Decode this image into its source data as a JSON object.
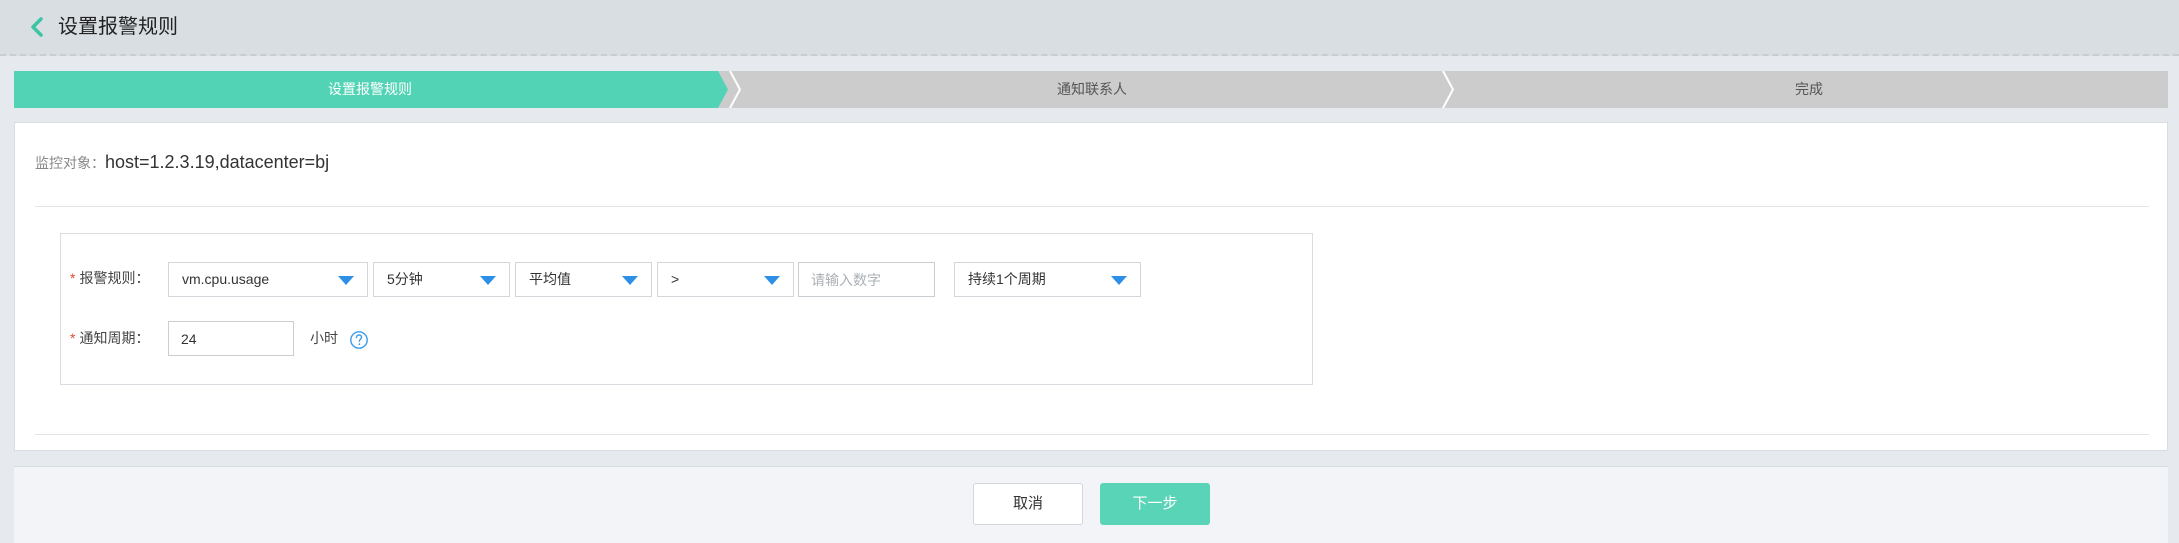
{
  "header": {
    "title": "设置报警规则",
    "back_icon": "chevron-left-icon"
  },
  "steps": [
    {
      "label": "设置报警规则",
      "active": true
    },
    {
      "label": "通知联系人",
      "active": false
    },
    {
      "label": "完成",
      "active": false
    }
  ],
  "monitor": {
    "label": "监控对象：",
    "value": "host=1.2.3.19,datacenter=bj"
  },
  "rule": {
    "label": "报警规则：",
    "metric": "vm.cpu.usage",
    "period": "5分钟",
    "aggregation": "平均值",
    "operator": ">",
    "threshold_placeholder": "请输入数字",
    "threshold_value": "",
    "duration": "持续1个周期"
  },
  "notify": {
    "label": "通知周期：",
    "value": "24",
    "unit": "小时",
    "help_icon": "question-circle-icon"
  },
  "footer": {
    "cancel_label": "取消",
    "next_label": "下一步"
  },
  "colors": {
    "accent": "#52d3b5",
    "step_inactive": "#cccccc",
    "required": "#e6492d",
    "caret": "#2e8fe6"
  }
}
